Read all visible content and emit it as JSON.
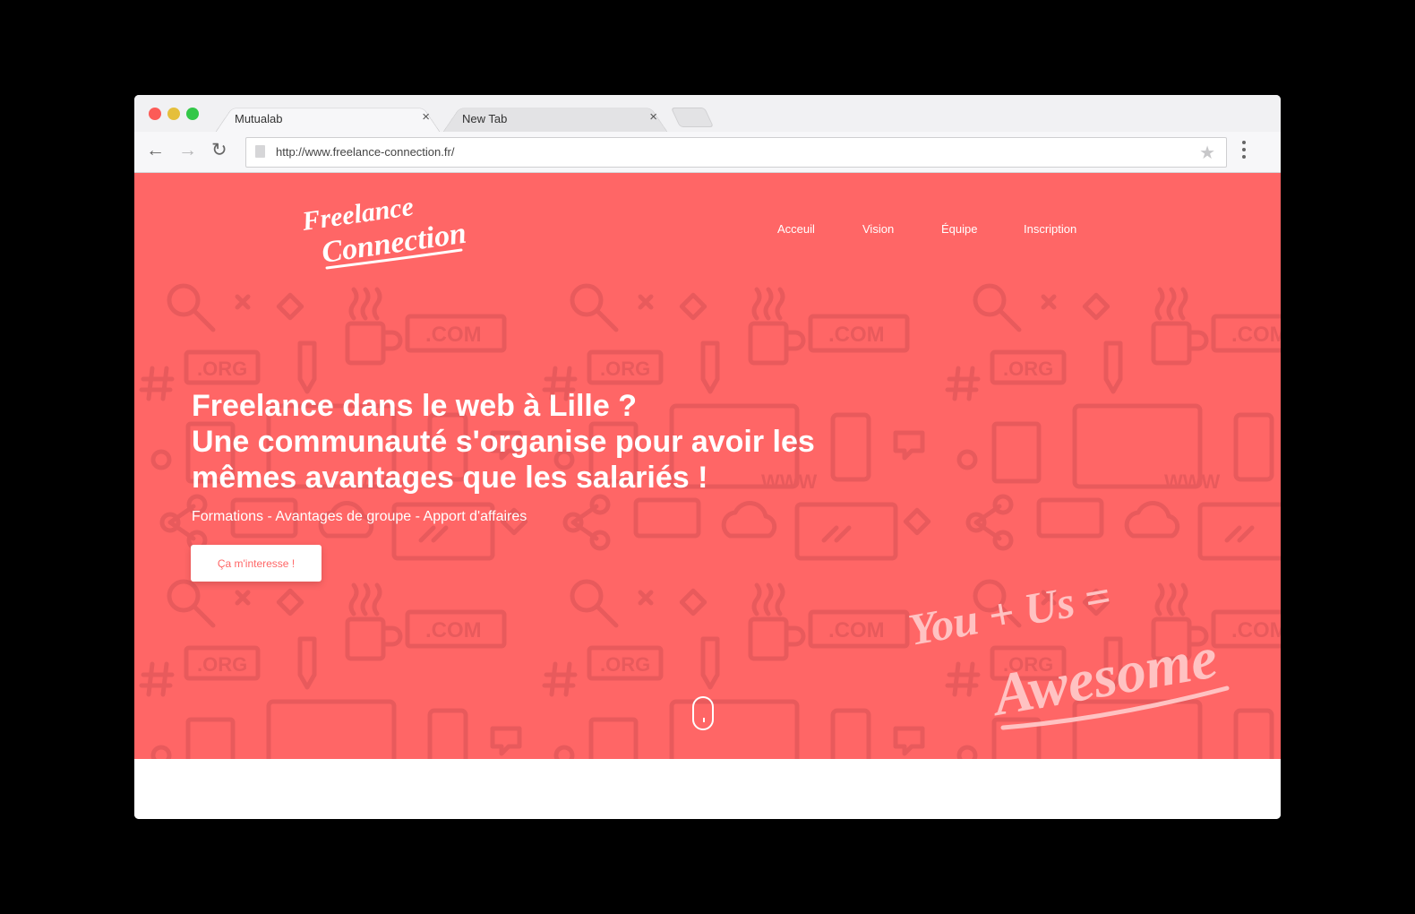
{
  "browser": {
    "tabs": [
      {
        "title": "Mutualab",
        "close": "×"
      },
      {
        "title": "New Tab",
        "close": "×"
      }
    ],
    "url": "http://www.freelance-connection.fr/",
    "icons": {
      "back": "←",
      "forward": "→",
      "reload": "↻",
      "star": "★"
    }
  },
  "site": {
    "logo_line1": "Freelance",
    "logo_line2": "Connection",
    "nav": [
      "Acceuil",
      "Vision",
      "Équipe",
      "Inscription"
    ],
    "hero": {
      "title_lines": [
        "Freelance dans le web à Lille ?",
        "Une communauté s'organise pour avoir les",
        "mêmes avantages que les salariés !"
      ],
      "subtitle": "Formations - Avantages de groupe - Apport d'affaires",
      "cta": "Ça m'interesse !",
      "tagline_line1": "You + Us =",
      "tagline_line2": "Awesome"
    },
    "colors": {
      "accent": "#ff6666",
      "pattern": "#e85a5c"
    }
  }
}
